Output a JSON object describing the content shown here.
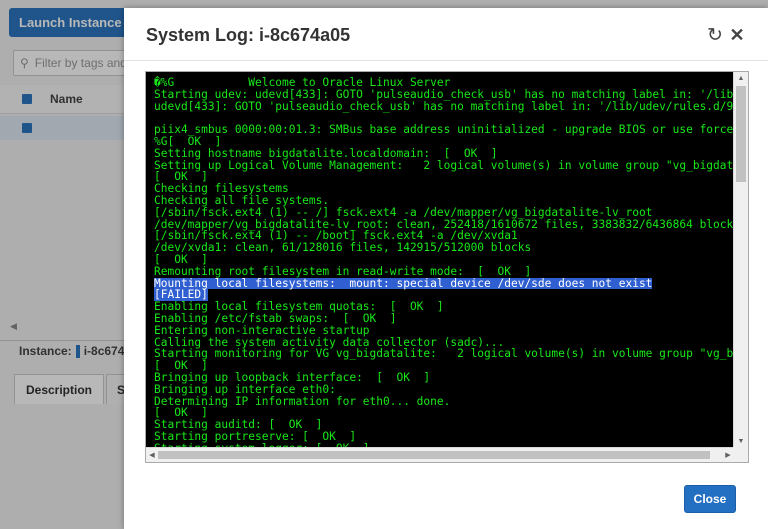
{
  "background": {
    "launch_button": "Launch Instance",
    "filter_placeholder": "Filter by tags and",
    "table_header_name": "Name",
    "instance_label": "Instance:",
    "instance_id_partial": "i-8c674",
    "tabs": [
      "Description",
      "S"
    ]
  },
  "modal": {
    "title": "System Log: i-8c674a05",
    "refresh_icon": "refresh-icon",
    "close_icon": "close-icon",
    "close_button": "Close",
    "log_lines": [
      "�%G           Welcome to Oracle Linux Server",
      "Starting udev: udevd[433]: GOTO 'pulseaudio_check_usb' has no matching label in: '/lib/ude",
      "udevd[433]: GOTO 'pulseaudio_check_usb' has no matching label in: '/lib/udev/rules.d/90-pu",
      "",
      "piix4_smbus 0000:00:01.3: SMBus base address uninitialized - upgrade BIOS or use force_add",
      "%G[  OK  ]",
      "Setting hostname bigdatalite.localdomain:  [  OK  ]",
      "Setting up Logical Volume Management:   2 logical volume(s) in volume group \"vg_bigdatalit",
      "[  OK  ]",
      "Checking filesystems",
      "Checking all file systems.",
      "[/sbin/fsck.ext4 (1) -- /] fsck.ext4 -a /dev/mapper/vg_bigdatalite-lv_root",
      "/dev/mapper/vg_bigdatalite-lv_root: clean, 252418/1610672 files, 3383832/6436864 blocks",
      "[/sbin/fsck.ext4 (1) -- /boot] fsck.ext4 -a /dev/xvda1",
      "/dev/xvda1: clean, 61/128016 files, 142915/512000 blocks",
      "[  OK  ]",
      "Remounting root filesystem in read-write mode:  [  OK  ]",
      "Mounting local filesystems:  mount: special device /dev/sde does not exist",
      "[FAILED]",
      "Enabling local filesystem quotas:  [  OK  ]",
      "Enabling /etc/fstab swaps:  [  OK  ]",
      "Entering non-interactive startup",
      "Calling the system activity data collector (sadc)...",
      "Starting monitoring for VG vg_bigdatalite:   2 logical volume(s) in volume group \"vg_bigda",
      "[  OK  ]",
      "Bringing up loopback interface:  [  OK  ]",
      "Bringing up interface eth0:",
      "Determining IP information for eth0... done.",
      "[  OK  ]",
      "Starting auditd: [  OK  ]",
      "Starting portreserve: [  OK  ]",
      "Starting system logger: [  OK  ]"
    ],
    "highlighted_lines": [
      17,
      18
    ]
  },
  "colors": {
    "accent": "#2370c2",
    "console_bg": "#000000",
    "console_text": "#18e818",
    "selection": "#2f5fd0"
  }
}
